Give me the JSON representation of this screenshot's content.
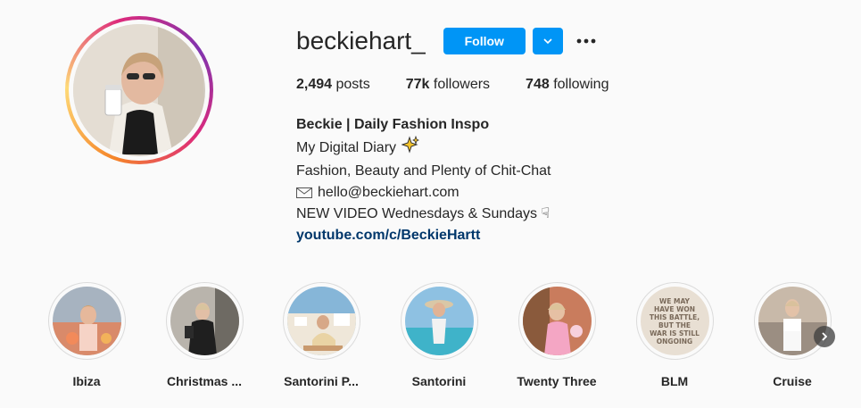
{
  "profile": {
    "username": "beckiehart_",
    "follow_label": "Follow",
    "stats": {
      "posts_count": "2,494",
      "posts_label": "posts",
      "followers_count": "77k",
      "followers_label": "followers",
      "following_count": "748",
      "following_label": "following"
    },
    "bio": {
      "name": "Beckie | Daily Fashion Inspo",
      "line1": "My Digital Diary",
      "line2": "Fashion, Beauty and Plenty of Chit-Chat",
      "line3": "hello@beckiehart.com",
      "line4": "NEW VIDEO Wednesdays & Sundays ☟",
      "link": "youtube.com/c/BeckieHartt"
    }
  },
  "highlights": [
    {
      "label": "Ibiza"
    },
    {
      "label": "Christmas ..."
    },
    {
      "label": "Santorini P..."
    },
    {
      "label": "Santorini"
    },
    {
      "label": "Twenty Three"
    },
    {
      "label": "BLM",
      "image_text": "WE MAY HAVE WON THIS BATTLE, BUT THE WAR IS STILL ONGOING"
    },
    {
      "label": "Cruise"
    }
  ],
  "colors": {
    "accent": "#0095f6",
    "link": "#00376b",
    "text": "#262626",
    "background": "#fafafa"
  },
  "icons": {
    "dropdown": "chevron-down-icon",
    "more": "more-options-icon",
    "envelope": "envelope-icon",
    "sparkle": "sparkles-icon",
    "next": "chevron-right-icon"
  }
}
